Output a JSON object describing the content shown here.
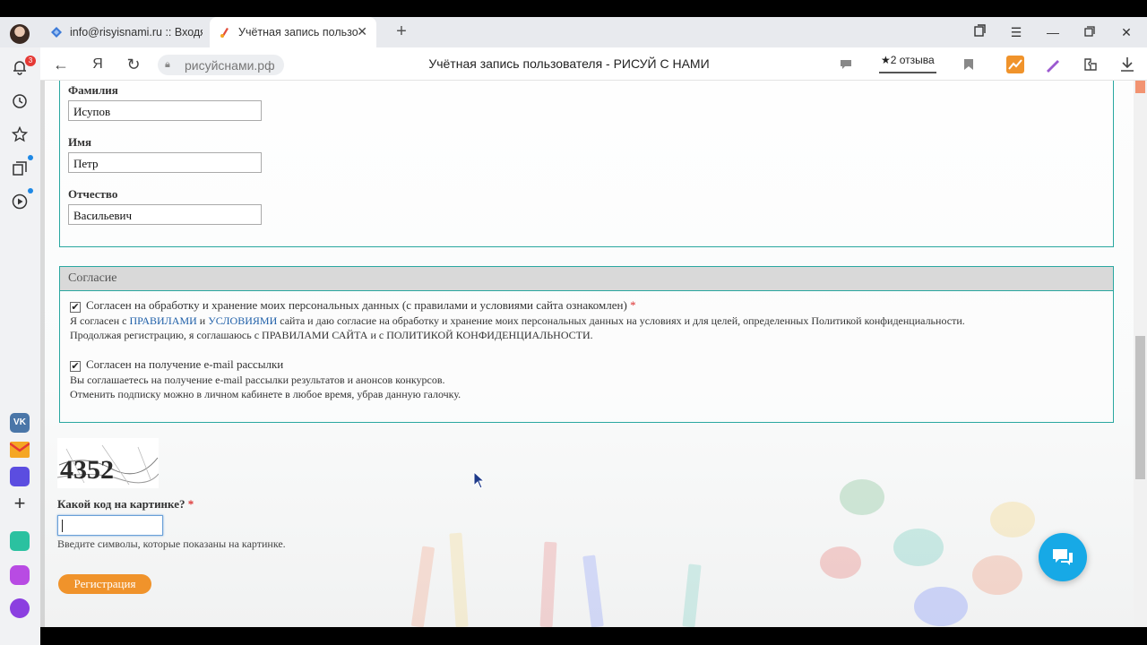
{
  "browser": {
    "tabs": [
      {
        "label": "info@risyisnami.ru :: Входя"
      },
      {
        "label": "Учётная запись пользо"
      }
    ],
    "address": "рисуйснами.рф",
    "page_title": "Учётная запись пользователя - РИСУЙ С НАМИ",
    "reviews_label": "★2 отзыва",
    "notification_count": "3"
  },
  "form": {
    "lastname_label": "Фамилия",
    "lastname_value": "Исупов",
    "firstname_label": "Имя",
    "firstname_value": "Петр",
    "patronymic_label": "Отчество",
    "patronymic_value": "Васильевич",
    "consent": {
      "legend": "Согласие",
      "personal_label": "Согласен на обработку и хранение моих персональных данных (с правилами и условиями сайта ознакомлен)",
      "required_mark": "*",
      "personal_desc_prefix": "Я согласен с",
      "rules_link": "ПРАВИЛАМИ",
      "and_word": "и",
      "terms_link": "УСЛОВИЯМИ",
      "personal_desc_suffix": "сайта и даю согласие на обработку и хранение моих персональных данных на условиях и для целей, определенных Политикой конфиденциальности.",
      "personal_desc_line2": "Продолжая регистрацию, я соглашаюсь с ПРАВИЛАМИ САЙТА и с ПОЛИТИКОЙ КОНФИДЕНЦИАЛЬНОСТИ.",
      "email_label": "Согласен на получение e-mail рассылки",
      "email_desc_line1": "Вы соглашаетесь на получение e-mail рассылки результатов и анонсов конкурсов.",
      "email_desc_line2": "Отменить подписку можно в личном кабинете в любое время, убрав данную галочку.",
      "check_mark": "✔"
    },
    "captcha": {
      "code_text": "4352",
      "label": "Какой код на картинке?",
      "required_mark": "*",
      "value": "",
      "help": "Введите символы, которые показаны на картинке."
    },
    "submit_label": "Регистрация"
  },
  "colors": {
    "accent_border": "#2aa7a0",
    "link": "#1f5fa8",
    "button": "#f0932b",
    "chat": "#17a9e6"
  }
}
